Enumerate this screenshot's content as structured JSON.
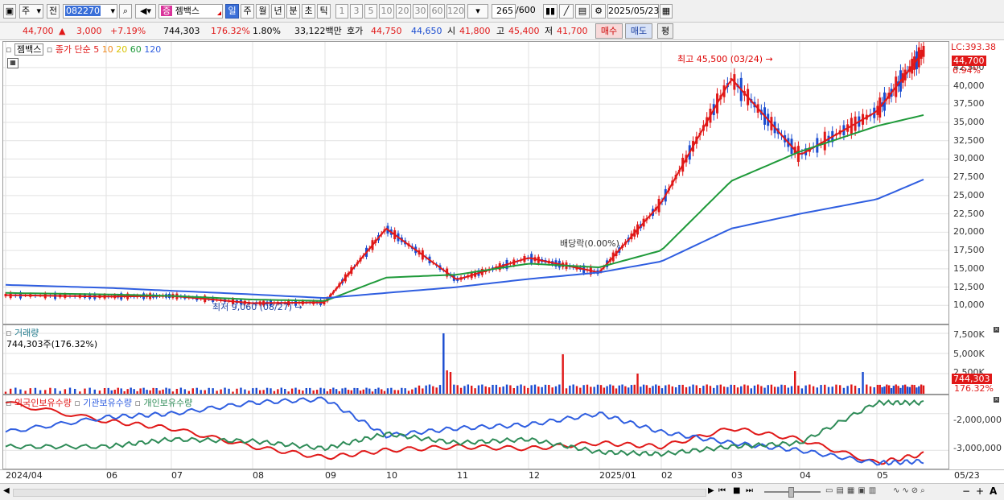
{
  "toolbar": {
    "market_type": "주",
    "prefix": "전",
    "stock_code": "082270",
    "stock_name": "젬백스",
    "period_tabs": [
      "일",
      "주",
      "월",
      "년",
      "분",
      "초",
      "틱"
    ],
    "active_period": "일",
    "interval_buttons": [
      "1",
      "3",
      "5",
      "10",
      "20",
      "30",
      "60",
      "120"
    ],
    "bar_count": "265",
    "bar_total": "/600",
    "date": "2025/05/23"
  },
  "info": {
    "price": "44,700",
    "change_arrow": "▲",
    "change": "3,000",
    "change_pct": "+7.19%",
    "volume": "744,303",
    "volume_ratio": "176.32%",
    "turnover": "1.80%",
    "trade_value": "33,122백만",
    "quote_label": "호가",
    "ask": "44,750",
    "bid": "44,650",
    "open_label": "시",
    "open": "41,800",
    "high_label": "고",
    "high": "45,400",
    "low_label": "저",
    "low": "41,700",
    "buy_btn": "매수",
    "sell_btn": "매도",
    "eval_btn": "평"
  },
  "price_panel": {
    "legend_name": "젬백스",
    "legend_prefix": "종가 단순",
    "ma_labels": [
      "5",
      "10",
      "20",
      "60",
      "120"
    ],
    "ma_colors": [
      "#e01818",
      "#f08a1e",
      "#f2e11c",
      "#1f9a3a",
      "#2f5ee0"
    ],
    "lc_label": "LC:393.38",
    "current_price_badge": "44,700",
    "current_pct_badge": "6.94%",
    "high_annotation": "최고 45,500 (03/24)",
    "low_annotation": "최저 9,060 (08/27)",
    "dividend_annotation": "배당락(0.00%)",
    "y_ticks": [
      "42,500",
      "40,000",
      "37,500",
      "35,000",
      "32,500",
      "30,000",
      "27,500",
      "25,000",
      "22,500",
      "20,000",
      "17,500",
      "15,000",
      "12,500",
      "10,000"
    ]
  },
  "volume_panel": {
    "title": "거래량",
    "value_label": "744,303주(176.32%)",
    "y_ticks": [
      "7,500K",
      "5,000K",
      "2,500K"
    ],
    "badge_value": "744,303",
    "badge_pct": "176.32%"
  },
  "holdings_panel": {
    "series_names": [
      "외국인보유수량",
      "기관보유수량",
      "개인보유수량"
    ],
    "series_colors": [
      "#e01818",
      "#2f5ee0",
      "#2e8b57"
    ],
    "y_ticks": [
      "-2,000,000",
      "-3,000,000"
    ]
  },
  "x_axis": {
    "labels": [
      "2024/04",
      "06",
      "07",
      "08",
      "09",
      "10",
      "11",
      "12",
      "2025/01",
      "02",
      "03",
      "04",
      "05"
    ],
    "end_label": "05/23"
  },
  "colors": {
    "up": "#e01818",
    "down": "#1a4cd0",
    "accent": "#3a6fd8"
  },
  "chart_data": [
    {
      "type": "line",
      "title": "젬백스 종가 단순 5 10 20 60 120",
      "x": [
        "2024/04",
        "06",
        "07",
        "08",
        "09",
        "10",
        "11",
        "12",
        "2025/01",
        "02",
        "03",
        "04",
        "05",
        "05/23"
      ],
      "series": [
        {
          "name": "5",
          "values": [
            11400,
            11200,
            11300,
            10300,
            10400,
            20500,
            13500,
            16500,
            14500,
            24000,
            41000,
            30500,
            36500,
            44700
          ]
        },
        {
          "name": "60",
          "values": [
            11700,
            11500,
            11300,
            10800,
            10600,
            13800,
            14200,
            15700,
            15200,
            17500,
            27000,
            31000,
            34500,
            36000
          ]
        },
        {
          "name": "120",
          "values": [
            12800,
            12400,
            12000,
            11500,
            11000,
            11700,
            12500,
            13600,
            14500,
            16000,
            20500,
            22500,
            24500,
            27200
          ]
        }
      ],
      "ylim": [
        7500,
        46000
      ],
      "annotations": [
        "최고 45,500 (03/24)",
        "최저 9,060 (08/27)",
        "배당락(0.00%)"
      ]
    },
    {
      "type": "line",
      "title": "외국인보유수량 기관보유수량 개인보유수량",
      "x": [
        "2024/04",
        "06",
        "07",
        "08",
        "09",
        "10",
        "11",
        "12",
        "2025/01",
        "02",
        "03",
        "04",
        "05",
        "05/23"
      ],
      "series": [
        {
          "name": "외국인보유수량",
          "values": [
            -1700000,
            -2200000,
            -2400000,
            -2900000,
            -3200000,
            -3000000,
            -2900000,
            -2950000,
            -2800000,
            -2900000,
            -2400000,
            -2700000,
            -3350000,
            -3100000
          ]
        },
        {
          "name": "기관보유수량",
          "values": [
            -2500000,
            -2100000,
            -2000000,
            -1700000,
            -1600000,
            -2600000,
            -2400000,
            -2300000,
            -2000000,
            -2500000,
            -2800000,
            -3000000,
            -3350000,
            -3300000
          ]
        },
        {
          "name": "개인보유수량",
          "values": [
            -2900000,
            -2900000,
            -2700000,
            -2750000,
            -2950000,
            -2550000,
            -2800000,
            -2700000,
            -3050000,
            -3100000,
            -2900000,
            -2800000,
            -1700000,
            -1700000
          ]
        }
      ],
      "ylim": [
        -3500000,
        -1500000
      ]
    }
  ]
}
